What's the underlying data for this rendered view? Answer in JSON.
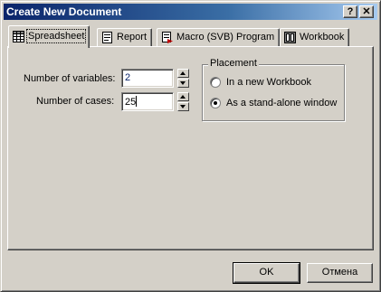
{
  "window": {
    "title": "Create New Document",
    "help_button": "?",
    "close_button": "✕"
  },
  "tabs": [
    {
      "label": "Spreadsheet",
      "icon": "spreadsheet-icon",
      "active": true
    },
    {
      "label": "Report",
      "icon": "report-icon",
      "active": false
    },
    {
      "label": "Macro (SVB) Program",
      "icon": "macro-icon",
      "active": false
    },
    {
      "label": "Workbook",
      "icon": "workbook-icon",
      "active": false
    }
  ],
  "form": {
    "variables_label": "Number of variables:",
    "variables_value": "2",
    "cases_label": "Number of cases:",
    "cases_value": "25"
  },
  "placement": {
    "title": "Placement",
    "options": [
      {
        "label": "In a new Workbook",
        "checked": false
      },
      {
        "label": "As a stand-alone window",
        "checked": true
      }
    ]
  },
  "buttons": {
    "ok": "OK",
    "cancel": "Отмена"
  },
  "colors": {
    "title_gradient_start": "#0a246a",
    "face": "#d4d0c8"
  }
}
